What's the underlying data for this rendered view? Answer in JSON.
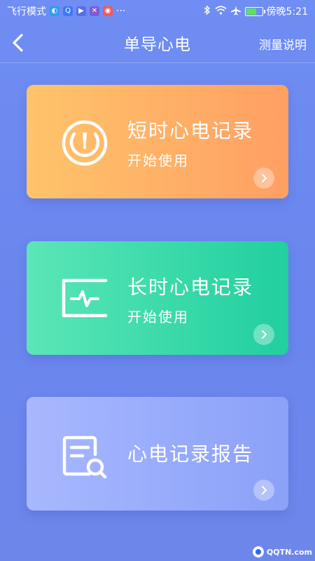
{
  "status_bar": {
    "left_text": "飞行模式",
    "more": "···",
    "time": "傍晚5:21"
  },
  "nav": {
    "title": "单导心电",
    "help": "测量说明"
  },
  "cards": [
    {
      "title": "短时心电记录",
      "subtitle": "开始使用",
      "icon": "gauge-icon"
    },
    {
      "title": "长时心电记录",
      "subtitle": "开始使用",
      "icon": "ecg-monitor-icon"
    },
    {
      "title": "心电记录报告",
      "icon": "report-search-icon"
    }
  ],
  "watermark": {
    "text": "QQTN.com"
  },
  "colors": {
    "background": "#6f8df3",
    "card1_start": "#ffc46b",
    "card1_end": "#ff9f63",
    "card2_start": "#5be6b7",
    "card2_end": "#21cf9f",
    "card3_start": "#a8b8ff",
    "card3_end": "#8ba1f8"
  }
}
